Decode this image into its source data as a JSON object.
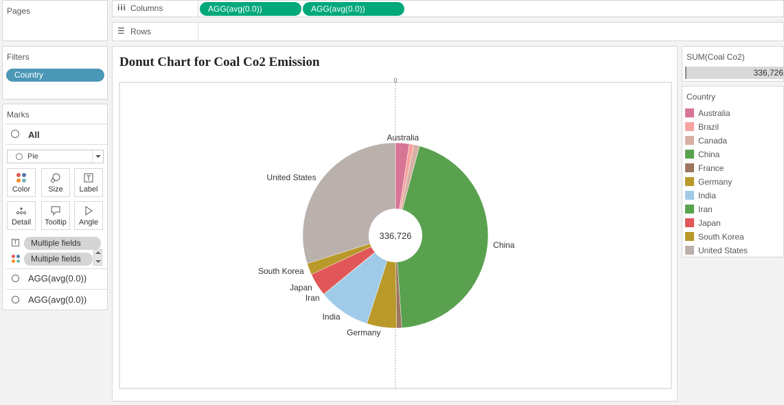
{
  "pages": {
    "label": "Pages"
  },
  "columns_shelf": {
    "label": "Columns",
    "pills": [
      "AGG(avg(0.0))",
      "AGG(avg(0.0))"
    ]
  },
  "rows_shelf": {
    "label": "Rows"
  },
  "filters": {
    "label": "Filters",
    "pills": [
      "Country"
    ]
  },
  "marks": {
    "label": "Marks",
    "all_label": "All",
    "mark_type": "Pie",
    "buttons": [
      "Color",
      "Size",
      "Label",
      "Detail",
      "Tooltip",
      "Angle"
    ],
    "fields": [
      "Multiple fields",
      "Multiple fields"
    ],
    "sections": [
      "AGG(avg(0.0))",
      "AGG(avg(0.0))"
    ]
  },
  "sum_card": {
    "label": "SUM(Coal Co2)",
    "value": "336,726"
  },
  "legend": {
    "title": "Country",
    "items": [
      {
        "name": "Australia",
        "color": "#d77594"
      },
      {
        "name": "Brazil",
        "color": "#f7a3a0"
      },
      {
        "name": "Canada",
        "color": "#d5b0a3"
      },
      {
        "name": "China",
        "color": "#59a14f"
      },
      {
        "name": "France",
        "color": "#9d7660"
      },
      {
        "name": "Germany",
        "color": "#b8992a"
      },
      {
        "name": "India",
        "color": "#a0cbe8"
      },
      {
        "name": "Iran",
        "color": "#59a14f"
      },
      {
        "name": "Japan",
        "color": "#e15759"
      },
      {
        "name": "South Korea",
        "color": "#b8992a"
      },
      {
        "name": "United States",
        "color": "#bab0ac"
      }
    ]
  },
  "chart_data": {
    "type": "pie",
    "title": "Donut Chart for Coal Co2 Emission",
    "center_label": "336,726",
    "axis_tick": "0",
    "slices": [
      {
        "name": "Australia",
        "value": 8080,
        "color": "#d77594",
        "label": "Australia"
      },
      {
        "name": "Brazil",
        "value": 2690,
        "color": "#f7a3a0",
        "label": ""
      },
      {
        "name": "Canada",
        "value": 3370,
        "color": "#d5b0a3",
        "label": ""
      },
      {
        "name": "China",
        "value": 150520,
        "color": "#59a14f",
        "label": "China"
      },
      {
        "name": "France",
        "value": 3030,
        "color": "#9d7660",
        "label": ""
      },
      {
        "name": "Germany",
        "value": 17510,
        "color": "#b8992a",
        "label": "Germany"
      },
      {
        "name": "India",
        "value": 30300,
        "color": "#a0cbe8",
        "label": "India"
      },
      {
        "name": "Iran",
        "value": 340,
        "color": "#59a14f",
        "label": "Iran"
      },
      {
        "name": "Japan",
        "value": 13470,
        "color": "#e15759",
        "label": "Japan"
      },
      {
        "name": "South Korea",
        "value": 6730,
        "color": "#b8992a",
        "label": "South Korea"
      },
      {
        "name": "United States",
        "value": 100686,
        "color": "#bab0ac",
        "label": "United States"
      }
    ]
  }
}
